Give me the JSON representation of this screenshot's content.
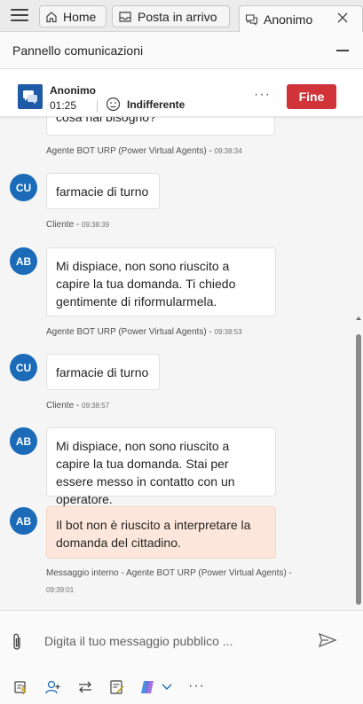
{
  "tabs": {
    "home_label": "Home",
    "inbox_label": "Posta in arrivo",
    "active_label": "Anonimo"
  },
  "panel": {
    "title": "Pannello comunicazioni"
  },
  "conversation": {
    "name": "Anonimo",
    "timer": "01:25",
    "sentiment": "Indifferente",
    "more_label": "···",
    "end_label": "Fine"
  },
  "messages": [
    {
      "avatar": "",
      "text": "cosa hai bisogno?",
      "sender": "Agente BOT URP (Power Virtual Agents) - ",
      "time": "09:38:34"
    },
    {
      "avatar": "CU",
      "text": "farmacie di turno",
      "sender": "Cliente - ",
      "time": "09:38:39"
    },
    {
      "avatar": "AB",
      "text": "Mi dispiace, non sono riuscito a capire la tua domanda. Ti chiedo gentimente di riformularmela.",
      "sender": "Agente BOT URP (Power Virtual Agents) - ",
      "time": "09:38:53"
    },
    {
      "avatar": "CU",
      "text": "farmacie di turno",
      "sender": "Cliente - ",
      "time": "09:38:57"
    },
    {
      "avatar": "AB",
      "text": "Mi dispiace, non sono riuscito a capire la tua domanda. Stai per essere messo in contatto con un operatore."
    },
    {
      "avatar": "AB",
      "text": "Il bot non è riuscito a interpretare la domanda del cittadino.",
      "sender": "Messaggio interno - Agente BOT URP (Power Virtual Agents) -",
      "time": "09:39:01"
    }
  ],
  "composer": {
    "placeholder": "Digita il tuo messaggio pubblico ...",
    "more_label": "···"
  },
  "colors": {
    "accent": "#1b6bb8",
    "end_button": "#d13438",
    "internal_note": "#fde7dc"
  },
  "icons": [
    "hamburger-menu-icon",
    "home-icon",
    "inbox-icon",
    "chat-icon",
    "close-icon",
    "minimize-icon",
    "neutral-face-icon",
    "attach-icon",
    "send-icon",
    "quick-reply-icon",
    "consult-icon",
    "transfer-icon",
    "notes-icon",
    "copilot-icon",
    "chevron-down-icon"
  ]
}
